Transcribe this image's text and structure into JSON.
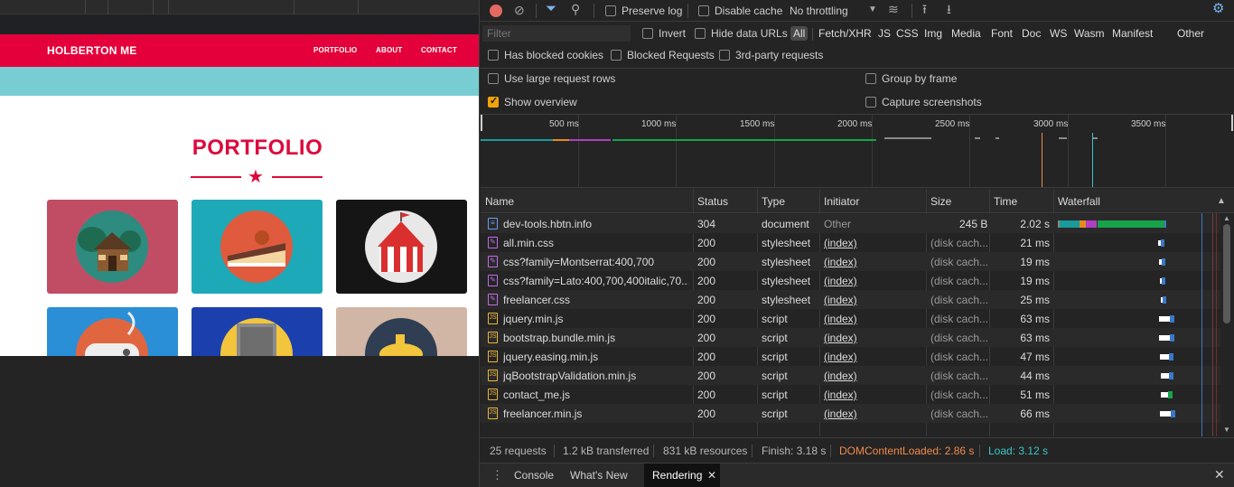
{
  "site": {
    "brand": "HOLBERTON ME",
    "nav": [
      "PORTFOLIO",
      "ABOUT",
      "CONTACT"
    ],
    "section_title": "PORTFOLIO",
    "tiles": [
      {
        "name": "cabin",
        "bg": "#c14d65"
      },
      {
        "name": "cake",
        "bg": "#1ea9b8"
      },
      {
        "name": "circus",
        "bg": "#151515"
      },
      {
        "name": "game-controller",
        "bg": "#2a8fd6"
      },
      {
        "name": "safe",
        "bg": "#1c3fae"
      },
      {
        "name": "submarine",
        "bg": "#d1b5a5"
      }
    ],
    "colors": {
      "accent": "#e4003a",
      "band": "#78cdd3"
    }
  },
  "devtools": {
    "toolbar": {
      "preserve_log": "Preserve log",
      "disable_cache": "Disable cache",
      "throttling": "No throttling"
    },
    "filter": {
      "placeholder": "Filter",
      "invert": "Invert",
      "hide_data_urls": "Hide data URLs",
      "types": [
        "All",
        "Fetch/XHR",
        "JS",
        "CSS",
        "Img",
        "Media",
        "Font",
        "Doc",
        "WS",
        "Wasm",
        "Manifest",
        "Other"
      ],
      "has_blocked_cookies": "Has blocked cookies",
      "blocked_requests": "Blocked Requests",
      "third_party": "3rd-party requests"
    },
    "settings": {
      "large_rows": "Use large request rows",
      "group_by_frame": "Group by frame",
      "show_overview": "Show overview",
      "capture_screenshots": "Capture screenshots"
    },
    "overview_ticks": [
      "500 ms",
      "1000 ms",
      "1500 ms",
      "2000 ms",
      "2500 ms",
      "3000 ms",
      "3500 ms"
    ],
    "columns": [
      "Name",
      "Status",
      "Type",
      "Initiator",
      "Size",
      "Time",
      "Waterfall"
    ],
    "requests": [
      {
        "name": "dev-tools.hbtn.info",
        "kind": "doc",
        "status": "304",
        "type": "document",
        "initiator": "Other",
        "size": "245 B",
        "time": "2.02 s"
      },
      {
        "name": "all.min.css",
        "kind": "css",
        "status": "200",
        "type": "stylesheet",
        "initiator": "(index)",
        "size": "(disk cach...",
        "time": "21 ms"
      },
      {
        "name": "css?family=Montserrat:400,700",
        "kind": "css",
        "status": "200",
        "type": "stylesheet",
        "initiator": "(index)",
        "size": "(disk cach...",
        "time": "19 ms"
      },
      {
        "name": "css?family=Lato:400,700,400italic,70...",
        "kind": "css",
        "status": "200",
        "type": "stylesheet",
        "initiator": "(index)",
        "size": "(disk cach...",
        "time": "19 ms"
      },
      {
        "name": "freelancer.css",
        "kind": "css",
        "status": "200",
        "type": "stylesheet",
        "initiator": "(index)",
        "size": "(disk cach...",
        "time": "25 ms"
      },
      {
        "name": "jquery.min.js",
        "kind": "js",
        "status": "200",
        "type": "script",
        "initiator": "(index)",
        "size": "(disk cach...",
        "time": "63 ms"
      },
      {
        "name": "bootstrap.bundle.min.js",
        "kind": "js",
        "status": "200",
        "type": "script",
        "initiator": "(index)",
        "size": "(disk cach...",
        "time": "63 ms"
      },
      {
        "name": "jquery.easing.min.js",
        "kind": "js",
        "status": "200",
        "type": "script",
        "initiator": "(index)",
        "size": "(disk cach...",
        "time": "47 ms"
      },
      {
        "name": "jqBootstrapValidation.min.js",
        "kind": "js",
        "status": "200",
        "type": "script",
        "initiator": "(index)",
        "size": "(disk cach...",
        "time": "44 ms"
      },
      {
        "name": "contact_me.js",
        "kind": "js",
        "status": "200",
        "type": "script",
        "initiator": "(index)",
        "size": "(disk cach...",
        "time": "51 ms"
      },
      {
        "name": "freelancer.min.js",
        "kind": "js",
        "status": "200",
        "type": "script",
        "initiator": "(index)",
        "size": "(disk cach...",
        "time": "66 ms"
      }
    ],
    "status": {
      "requests": "25 requests",
      "transferred": "1.2 kB transferred",
      "resources": "831 kB resources",
      "finish": "Finish: 3.18 s",
      "dom_content_loaded": "DOMContentLoaded: 2.86 s",
      "load": "Load: 3.12 s"
    },
    "drawer_tabs": [
      "Console",
      "What's New",
      "Rendering"
    ],
    "colors": {
      "dcl": "#f08a4b",
      "load": "#3dc6c6",
      "record": "#e46962",
      "checkbox": "#f0a30a"
    }
  }
}
